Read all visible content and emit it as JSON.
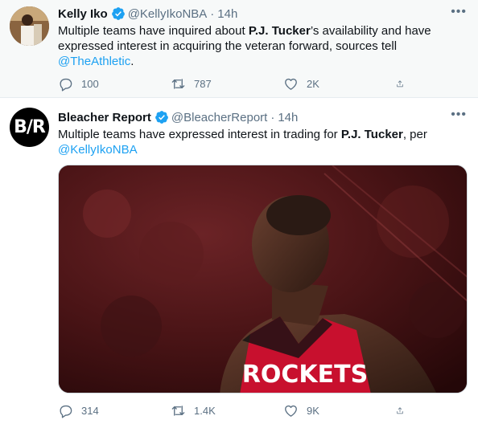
{
  "colors": {
    "link": "#1da1f2",
    "muted": "#5b7083",
    "verified": "#1da1f2",
    "jersey": "#c8102e"
  },
  "tweets": [
    {
      "name": "Kelly Iko",
      "handle": "@KellyIkoNBA",
      "separator": "·",
      "time": "14h",
      "more": "•••",
      "text_parts": [
        "Multiple teams have inquired about ",
        "P.J. Tucker",
        "’s availability and have expressed interest in acquiring the veteran forward, sources tell ",
        "@TheAthletic",
        "."
      ],
      "replies": "100",
      "retweets": "787",
      "likes": "2K"
    },
    {
      "name": "Bleacher Report",
      "handle": "@BleacherReport",
      "separator": "·",
      "time": "14h",
      "more": "•••",
      "avatar_text": "B/R",
      "text_parts": [
        "Multiple teams have expressed interest in trading for ",
        "P.J. Tucker",
        ", per",
        "@KellyIkoNBA"
      ],
      "jersey_text": "ROCKETS",
      "replies": "314",
      "retweets": "1.4K",
      "likes": "9K"
    }
  ]
}
